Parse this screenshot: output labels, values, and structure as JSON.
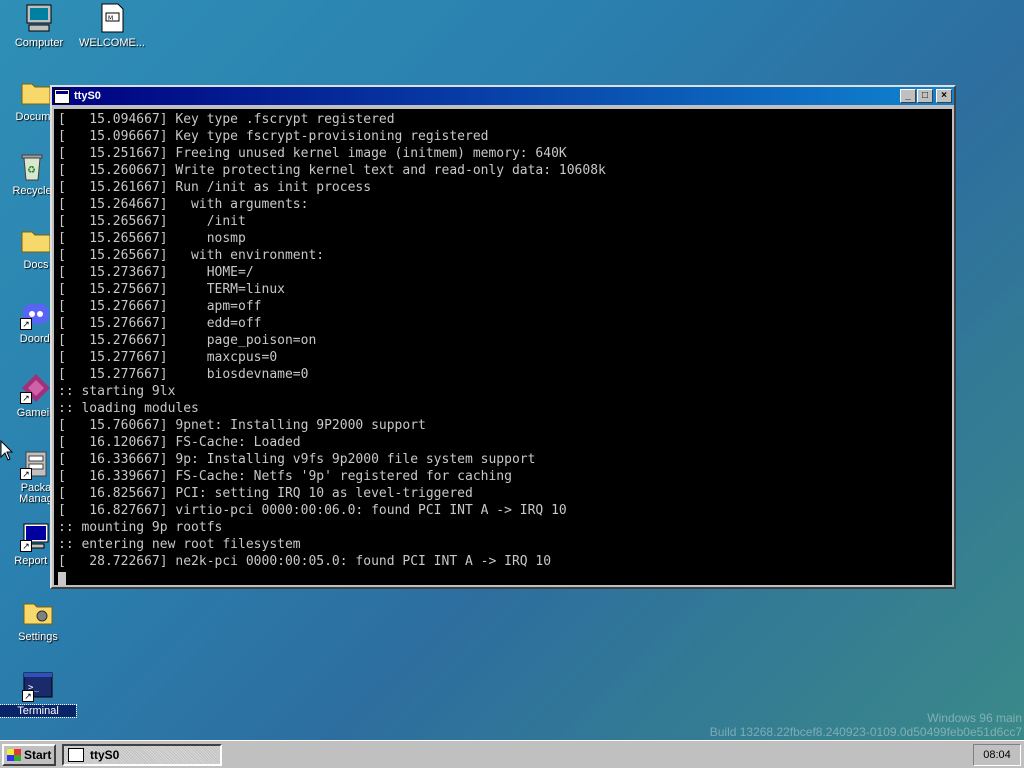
{
  "desktop": {
    "icons": [
      {
        "label": "Computer",
        "icon": "computer-icon"
      },
      {
        "label": "WELCOME...",
        "icon": "document-icon"
      },
      {
        "label": "Docume",
        "icon": "folder-icon"
      },
      {
        "label": "Recycle",
        "icon": "recycle-bin-icon"
      },
      {
        "label": "Docs",
        "icon": "folder-icon"
      },
      {
        "label": "Doordi",
        "icon": "discord-icon"
      },
      {
        "label": "Gamein",
        "icon": "game-icon"
      },
      {
        "label": "Packa\nManag",
        "icon": "package-manager-icon"
      },
      {
        "label": "Report B",
        "icon": "report-icon"
      },
      {
        "label": "Settings",
        "icon": "settings-icon"
      },
      {
        "label": "Terminal",
        "icon": "terminal-icon"
      }
    ],
    "watermark_line1": "Windows 96 main",
    "watermark_line2": "Build 13268.22fbcef8.240923-0109.0d50499feb0e51d6cc7"
  },
  "window": {
    "title": "ttyS0",
    "minimize_label": "_",
    "maximize_label": "□",
    "close_label": "×"
  },
  "terminal": {
    "lines": [
      "[   15.094667] Key type .fscrypt registered",
      "[   15.096667] Key type fscrypt-provisioning registered",
      "[   15.251667] Freeing unused kernel image (initmem) memory: 640K",
      "[   15.260667] Write protecting kernel text and read-only data: 10608k",
      "[   15.261667] Run /init as init process",
      "[   15.264667]   with arguments:",
      "[   15.265667]     /init",
      "[   15.265667]     nosmp",
      "[   15.265667]   with environment:",
      "[   15.273667]     HOME=/",
      "[   15.275667]     TERM=linux",
      "[   15.276667]     apm=off",
      "[   15.276667]     edd=off",
      "[   15.276667]     page_poison=on",
      "[   15.277667]     maxcpus=0",
      "[   15.277667]     biosdevname=0",
      ":: starting 9lx",
      ":: loading modules",
      "[   15.760667] 9pnet: Installing 9P2000 support",
      "[   16.120667] FS-Cache: Loaded",
      "[   16.336667] 9p: Installing v9fs 9p2000 file system support",
      "[   16.339667] FS-Cache: Netfs '9p' registered for caching",
      "[   16.825667] PCI: setting IRQ 10 as level-triggered",
      "[   16.827667] virtio-pci 0000:00:06.0: found PCI INT A -> IRQ 10",
      ":: mounting 9p rootfs",
      ":: entering new root filesystem",
      "[   28.722667] ne2k-pci 0000:00:05.0: found PCI INT A -> IRQ 10"
    ]
  },
  "taskbar": {
    "start_label": "Start",
    "tasks": [
      {
        "label": "ttyS0"
      }
    ],
    "clock": "08:04"
  }
}
